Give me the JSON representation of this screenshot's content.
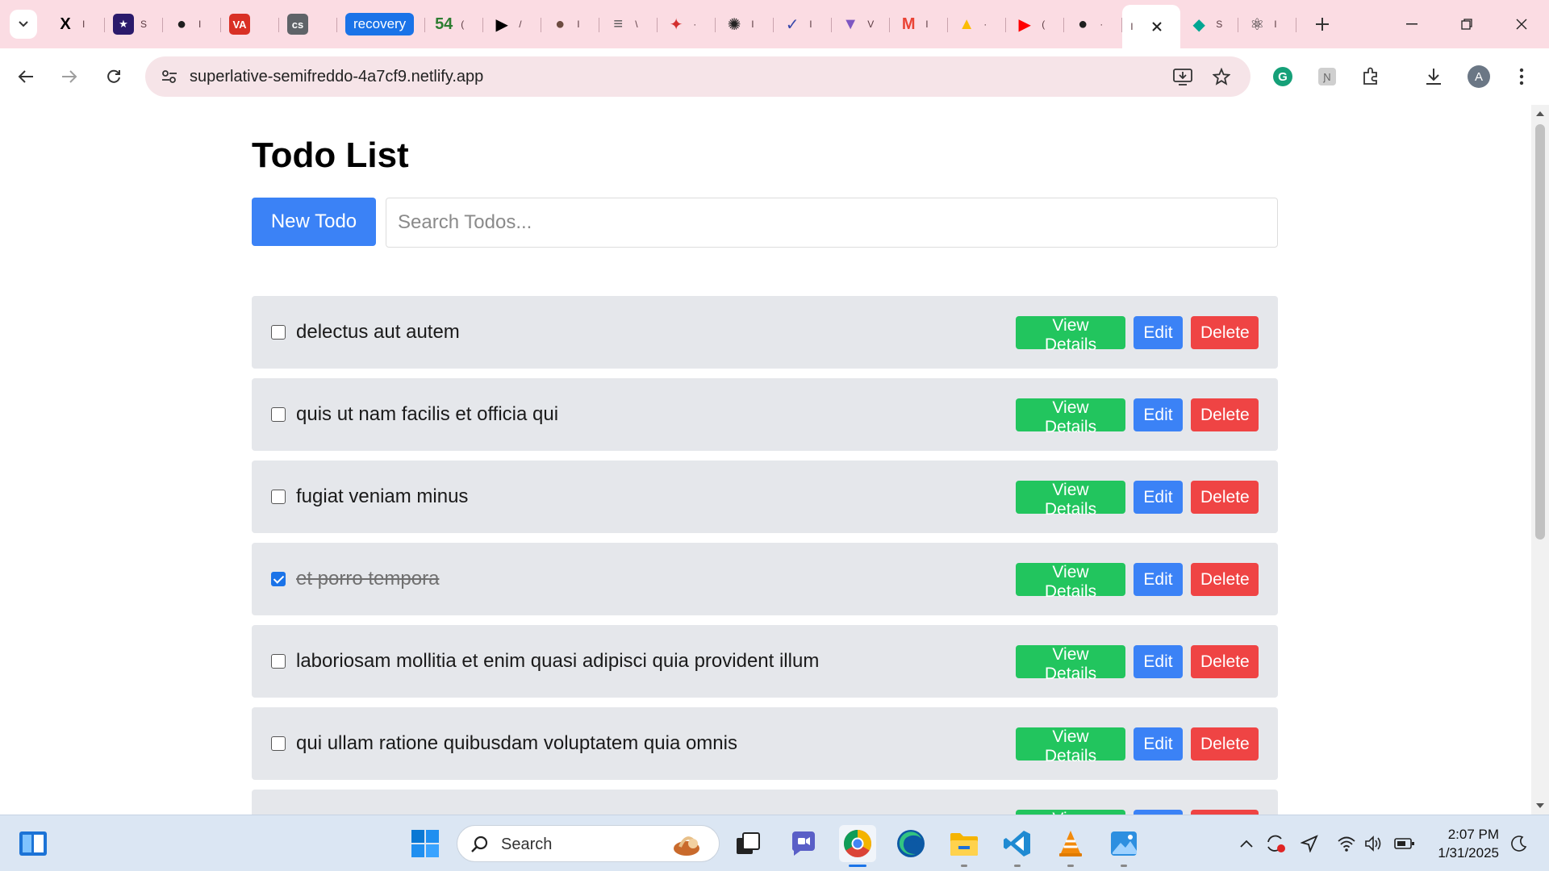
{
  "browser": {
    "tabs": [
      {
        "icon": "x-icon",
        "title": "I",
        "color": "#000000",
        "glyph": "X"
      },
      {
        "icon": "sparkle-app-icon",
        "title": "S",
        "color": "#2b1a6b",
        "glyph": "★"
      },
      {
        "icon": "github-icon",
        "title": "I",
        "color": "#1f1f1f",
        "glyph": "●"
      },
      {
        "icon": "va-icon",
        "title": "",
        "color": "#d93025",
        "glyph": "VA"
      },
      {
        "icon": "cs-icon",
        "title": "",
        "color": "#5f6368",
        "glyph": "cs"
      },
      {
        "icon": "recovery-pill",
        "title": "recovery",
        "color": "#1a73e8",
        "glyph": ""
      },
      {
        "icon": "counter-icon",
        "title": "(",
        "color": "#2e7d32",
        "glyph": "54"
      },
      {
        "icon": "play-icon",
        "title": "/",
        "color": "#000000",
        "glyph": "▶"
      },
      {
        "icon": "avatar-icon",
        "title": "I",
        "color": "#6d4c41",
        "glyph": "●"
      },
      {
        "icon": "notes-icon",
        "title": "\\",
        "color": "#555555",
        "glyph": "≡"
      },
      {
        "icon": "runner-icon",
        "title": "·",
        "color": "#d32f2f",
        "glyph": "✦"
      },
      {
        "icon": "openai-icon",
        "title": "I",
        "color": "#222222",
        "glyph": "✺"
      },
      {
        "icon": "dev-icon",
        "title": "I",
        "color": "#3949ab",
        "glyph": "✓"
      },
      {
        "icon": "vite-icon",
        "title": "V",
        "color": "#7e57c2",
        "glyph": "▼"
      },
      {
        "icon": "gmail-icon",
        "title": "I",
        "color": "#ea4335",
        "glyph": "M"
      },
      {
        "icon": "drive-icon",
        "title": "·",
        "color": "#fbbc04",
        "glyph": "▲"
      },
      {
        "icon": "youtube-icon",
        "title": "(",
        "color": "#ff0000",
        "glyph": "▶"
      },
      {
        "icon": "github-icon",
        "title": "·",
        "color": "#1f1f1f",
        "glyph": "●"
      }
    ],
    "active_tab": {
      "icon": "page-icon",
      "title": "I"
    },
    "after_tabs": [
      {
        "icon": "diamond-icon",
        "title": "S",
        "color": "#00a693",
        "glyph": "◆"
      },
      {
        "icon": "react-icon",
        "title": "I",
        "color": "#222222",
        "glyph": "⚛"
      }
    ],
    "url": "superlative-semifreddo-4a7cf9.netlify.app",
    "profile_initial": "A"
  },
  "page": {
    "title": "Todo List",
    "new_todo_label": "New Todo",
    "search_placeholder": "Search Todos...",
    "buttons": {
      "view": "View Details",
      "edit": "Edit",
      "delete": "Delete"
    },
    "todos": [
      {
        "text": "delectus aut autem",
        "completed": false
      },
      {
        "text": "quis ut nam facilis et officia qui",
        "completed": false
      },
      {
        "text": "fugiat veniam minus",
        "completed": false
      },
      {
        "text": "et porro tempora",
        "completed": true
      },
      {
        "text": "laboriosam mollitia et enim quasi adipisci quia provident illum",
        "completed": false
      },
      {
        "text": "qui ullam ratione quibusdam voluptatem quia omnis",
        "completed": false
      },
      {
        "text": "",
        "completed": false
      }
    ]
  },
  "taskbar": {
    "search_label": "Search",
    "time": "2:07 PM",
    "date": "1/31/2025"
  },
  "colors": {
    "primary": "#3b82f6",
    "success": "#22c55e",
    "danger": "#ef4444",
    "row_bg": "#e5e7eb",
    "tabstrip_bg": "#fbdce3"
  }
}
